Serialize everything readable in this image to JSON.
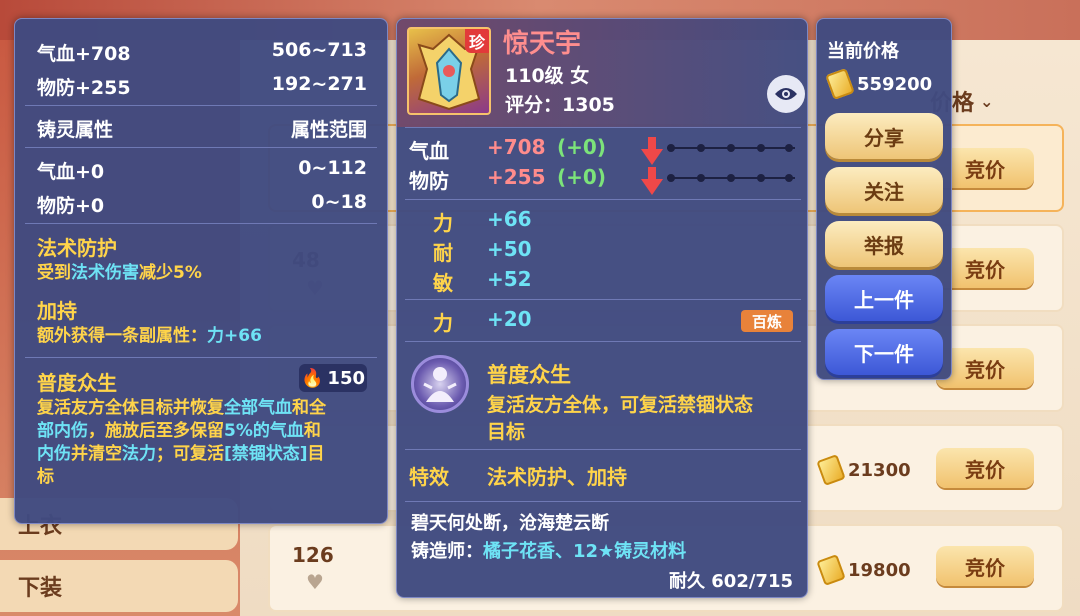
{
  "background": {
    "category_1": "上衣",
    "category_2": "下装",
    "list_header": "价格",
    "bid_label": "竞价",
    "rows": [
      {
        "price": "",
        "num": ""
      },
      {
        "price": "",
        "num": "48"
      },
      {
        "price": "",
        "num": ""
      },
      {
        "price": "21300",
        "num": ""
      },
      {
        "price": "19800",
        "num": "126"
      }
    ]
  },
  "left": {
    "base_attrs": [
      {
        "name": "气血+708",
        "range": "506~713"
      },
      {
        "name": "物防+255",
        "range": "192~271"
      }
    ],
    "zhuling_title": "铸灵属性",
    "zhuling_range_title": "属性范围",
    "zhuling_attrs": [
      {
        "name": "气血+0",
        "range": "0~112"
      },
      {
        "name": "物防+0",
        "range": "0~18"
      }
    ],
    "effect1_title": "法术防护",
    "effect1_desc_a": "受到",
    "effect1_desc_b": "法术伤害",
    "effect1_desc_c": "减少5%",
    "effect2_title": "加持",
    "effect2_desc_a": "额外获得一条副属性：",
    "effect2_desc_b": "力+66",
    "skill_title": "普度众生",
    "skill_cost": "150",
    "skill_desc_1a": "复活友方全体目标并恢复",
    "skill_desc_1b": "全部气血",
    "skill_desc_1c": "和全",
    "skill_desc_2a": "部内伤",
    "skill_desc_2b": "，施放后至多保留",
    "skill_desc_2c": "5%的气血",
    "skill_desc_2d": "和",
    "skill_desc_3a": "内伤",
    "skill_desc_3b": "并清空",
    "skill_desc_3c": "法力",
    "skill_desc_3d": "；可复活",
    "skill_desc_3e": "[禁锢状态]",
    "skill_desc_3f": "目",
    "skill_desc_4": "标"
  },
  "middle": {
    "name": "惊天宇",
    "rare_tag": "珍",
    "level": "110级 女",
    "score": "评分：1305",
    "stats": [
      {
        "label": "气血",
        "value": "+708",
        "delta": "(+0)"
      },
      {
        "label": "物防",
        "value": "+255",
        "delta": "(+0)"
      }
    ],
    "sub_attrs": [
      {
        "label": "力",
        "value": "+66"
      },
      {
        "label": "耐",
        "value": "+50"
      },
      {
        "label": "敏",
        "value": "+52"
      }
    ],
    "extra_attr": {
      "label": "力",
      "value": "+20",
      "tag": "百炼"
    },
    "skill_name": "普度众生",
    "skill_desc_1": "复活友方全体，可复活禁锢状态",
    "skill_desc_2": "目标",
    "special_label": "特效",
    "special_value": "法术防护、加持",
    "poem": "碧天何处断，沧海楚云断",
    "maker_label": "铸造师：",
    "maker_value": "橘子花香、12★铸灵材料",
    "durability": "耐久 602/715"
  },
  "right": {
    "price_label": "当前价格",
    "price_value": "559200",
    "buttons": {
      "share": "分享",
      "follow": "关注",
      "report": "举报",
      "prev": "上一件",
      "next": "下一件"
    }
  }
}
